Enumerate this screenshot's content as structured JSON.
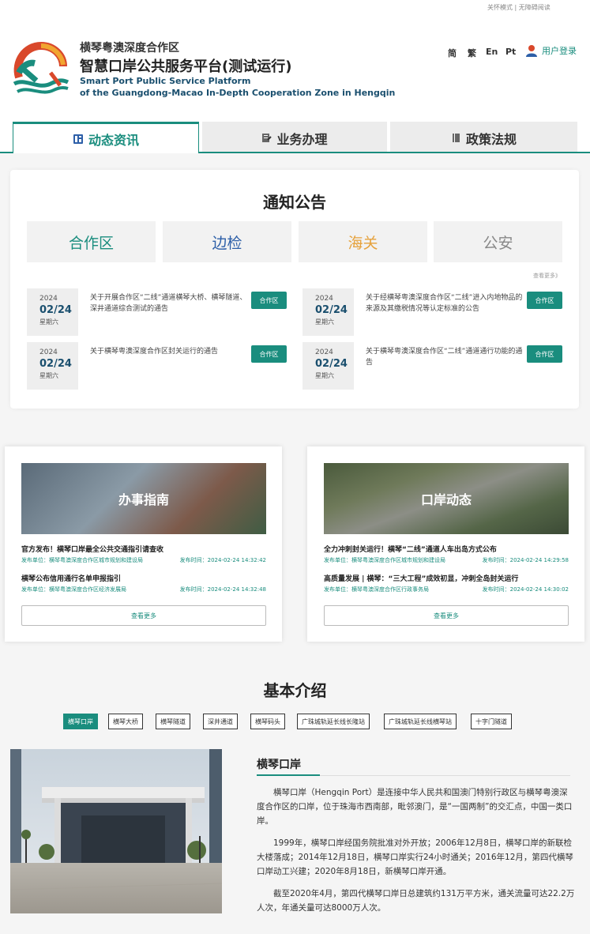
{
  "top_links": "关怀模式 | 无障碍阅读",
  "header": {
    "org_name": "横琴粤澳深度合作区",
    "platform_title": "智慧口岸公共服务平台(测试运行)",
    "en_line1": "Smart Port Public Service Platform",
    "en_line2": "of the Guangdong-Macao In-Depth Cooperation Zone in Hengqin",
    "languages": [
      "简",
      "繁",
      "En",
      "Pt"
    ],
    "login_label": "用户登录"
  },
  "nav_tabs": [
    {
      "label": "动态资讯",
      "icon": "news-icon",
      "active": true
    },
    {
      "label": "业务办理",
      "icon": "business-icon",
      "active": false
    },
    {
      "label": "政策法规",
      "icon": "policy-icon",
      "active": false
    }
  ],
  "notices": {
    "title": "通知公告",
    "categories": [
      {
        "label": "合作区",
        "color": "#1a8d7e"
      },
      {
        "label": "边检",
        "color": "#2d5fa8"
      },
      {
        "label": "海关",
        "color": "#e6a23c"
      },
      {
        "label": "公安",
        "color": "#888888"
      }
    ],
    "more_label": "查看更多》",
    "items": [
      {
        "year": "2024",
        "md": "02/24",
        "weekday": "星期六",
        "text": "关于开展合作区“二线”通道横琴大桥、横琴隧道、深井通道综合测试的通告",
        "badge": "合作区"
      },
      {
        "year": "2024",
        "md": "02/24",
        "weekday": "星期六",
        "text": "关于经横琴粤澳深度合作区“二线”进入内地物品的来源及其缴税情况等认定标准的公告",
        "badge": "合作区"
      },
      {
        "year": "2024",
        "md": "02/24",
        "weekday": "星期六",
        "text": "关于横琴粤澳深度合作区封关运行的通告",
        "badge": "合作区"
      },
      {
        "year": "2024",
        "md": "02/24",
        "weekday": "星期六",
        "text": "关于横琴粤澳深度合作区“二线”通道通行功能的通告",
        "badge": "合作区"
      }
    ]
  },
  "guide_panel": {
    "banner_title": "办事指南",
    "items": [
      {
        "title": "官方发布！横琴口岸最全公共交通指引请查收",
        "unit": "发布单位：横琴粤澳深度合作区城市规划和建设局",
        "time": "发布时间：2024-02-24 14:32:42"
      },
      {
        "title": "横琴公布信用通行名单申报指引",
        "unit": "发布单位：横琴粤澳深度合作区经济发展局",
        "time": "发布时间：2024-02-24 14:32:48"
      }
    ],
    "more_label": "查看更多"
  },
  "port_news_panel": {
    "banner_title": "口岸动态",
    "items": [
      {
        "title": "全力冲刺封关运行！横琴“二线”通道人车出岛方式公布",
        "unit": "发布单位：横琴粤澳深度合作区城市规划和建设局",
        "time": "发布时间：2024-02-24 14:29:58"
      },
      {
        "title": "高质量发展 | 横琴：“三大工程”成效初显，冲刺全岛封关运行",
        "unit": "发布单位：横琴粤澳深度合作区行政事务局",
        "time": "发布时间：2024-02-24 14:30:02"
      }
    ],
    "more_label": "查看更多"
  },
  "intro": {
    "title": "基本介绍",
    "pills": [
      "横琴口岸",
      "横琴大桥",
      "横琴隧道",
      "深井通道",
      "横琴码头",
      "广珠城轨延长线长隆站",
      "广珠城轨延长线横琴站",
      "十字门隧道"
    ],
    "active_pill": 0,
    "port_title": "横琴口岸",
    "paragraphs": [
      "横琴口岸（Hengqin Port）是连接中华人民共和国澳门特别行政区与横琴粤澳深度合作区的口岸，位于珠海市西南部，毗邻澳门，是“一国两制”的交汇点，中国一类口岸。",
      "1999年，横琴口岸经国务院批准对外开放；2006年12月8日，横琴口岸的新联检大楼落成；2014年12月18日，横琴口岸实行24小时通关；2016年12月，第四代横琴口岸动工兴建；2020年8月18日，新横琴口岸开通。",
      "截至2020年4月，第四代横琴口岸日总建筑约131万平方米，通关流量可达22.2万人次，年通关量可达8000万人次。"
    ]
  },
  "colors": {
    "accent": "#1a8d7e",
    "navy": "#1a4f6e"
  }
}
